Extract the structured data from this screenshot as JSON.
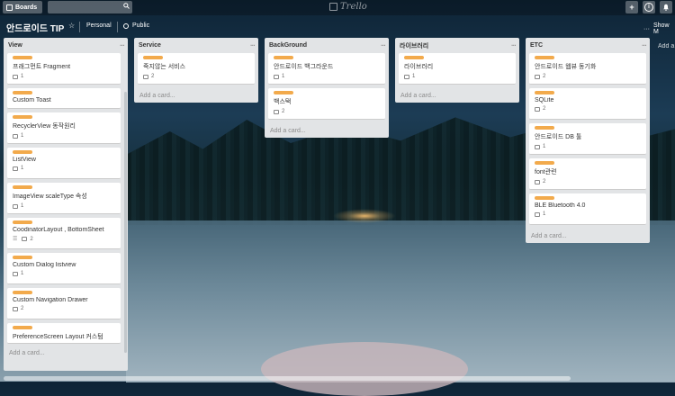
{
  "header": {
    "boards_label": "Boards",
    "search_placeholder": "",
    "logo_text": "Trello",
    "add_icon": "+",
    "info_icon": "i",
    "bell_icon": "bell"
  },
  "board": {
    "title": "안드로이드 TIP",
    "visibility_team": "Personal",
    "visibility": "Public",
    "show_menu": "Show M"
  },
  "lists": [
    {
      "name": "View",
      "cards": [
        {
          "title": "프래그먼트 Fragment",
          "comments": "1"
        },
        {
          "title": "Custom Toast",
          "comments": ""
        },
        {
          "title": "RecyclerView 동작원리",
          "comments": "1"
        },
        {
          "title": "ListView",
          "comments": "1"
        },
        {
          "title": "ImageView scaleType 속성",
          "comments": "1"
        },
        {
          "title": "CoodinatorLayout , BottomSheet",
          "comments": "2",
          "desc": true
        },
        {
          "title": "Custom Dialog listview",
          "comments": "1"
        },
        {
          "title": "Custom Navigation Drawer",
          "comments": "2"
        },
        {
          "title": "PreferenceScreen Layout 커스텀",
          "comments": ""
        }
      ],
      "add_label": "Add a card..."
    },
    {
      "name": "Service",
      "cards": [
        {
          "title": "죽지않는 서비스",
          "comments": "2"
        }
      ],
      "add_label": "Add a card..."
    },
    {
      "name": "BackGround",
      "cards": [
        {
          "title": "안드로이드 백그라운드",
          "comments": "1"
        },
        {
          "title": "백스택",
          "comments": "2"
        }
      ],
      "add_label": "Add a card..."
    },
    {
      "name": "라이브러리",
      "cards": [
        {
          "title": "라이브러리",
          "comments": "1"
        }
      ],
      "add_label": "Add a card..."
    },
    {
      "name": "ETC",
      "cards": [
        {
          "title": "안드로이드 웹뷰 동기화",
          "comments": "2"
        },
        {
          "title": "SQLite",
          "comments": "2"
        },
        {
          "title": "안드로이드 DB 툴",
          "comments": "1"
        },
        {
          "title": "font관련",
          "comments": "2"
        },
        {
          "title": "BLE Bluetooth 4.0",
          "comments": "1"
        }
      ],
      "add_label": "Add a card..."
    }
  ],
  "add_list_label": "Add a"
}
